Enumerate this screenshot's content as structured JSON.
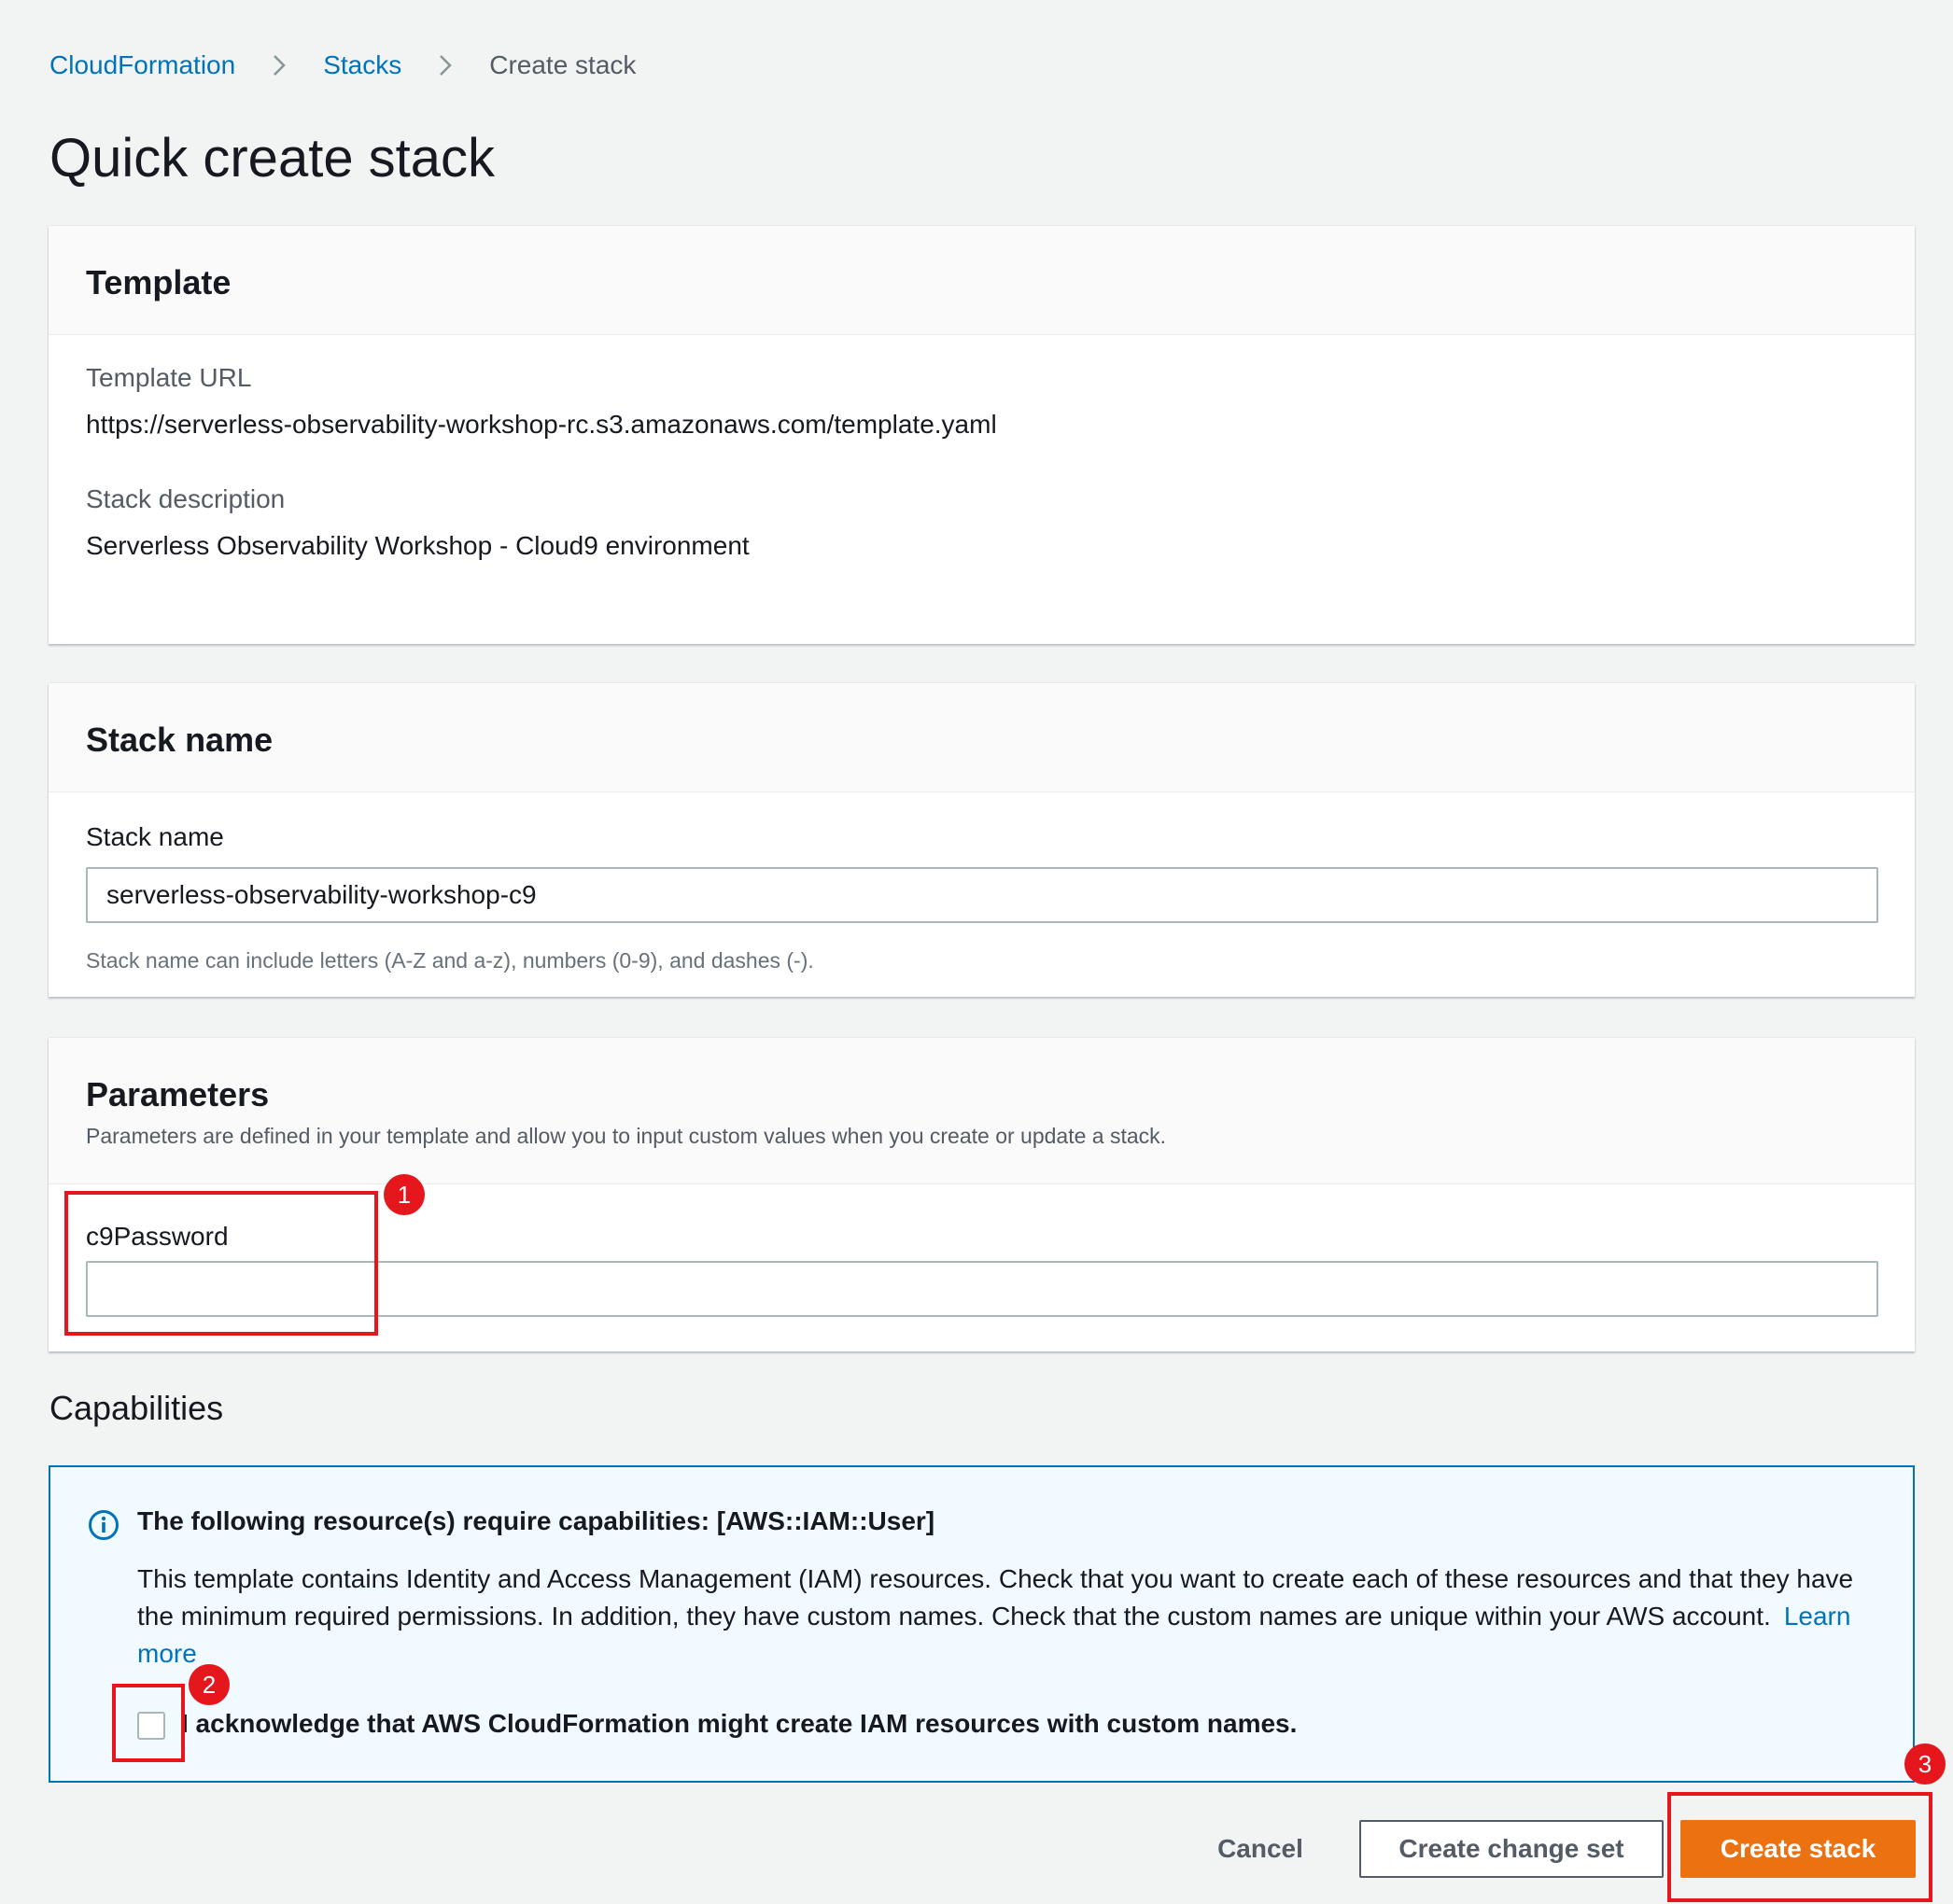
{
  "breadcrumb": {
    "items": [
      "CloudFormation",
      "Stacks"
    ],
    "current": "Create stack"
  },
  "page_title": "Quick create stack",
  "template_panel": {
    "title": "Template",
    "url_label": "Template URL",
    "url_value": "https://serverless-observability-workshop-rc.s3.amazonaws.com/template.yaml",
    "desc_label": "Stack description",
    "desc_value": "Serverless Observability Workshop - Cloud9 environment"
  },
  "stack_name_panel": {
    "title": "Stack name",
    "field_label": "Stack name",
    "field_value": "serverless-observability-workshop-c9",
    "hint": "Stack name can include letters (A-Z and a-z), numbers (0-9), and dashes (-)."
  },
  "parameters_panel": {
    "title": "Parameters",
    "description": "Parameters are defined in your template and allow you to input custom values when you create or update a stack.",
    "param_label": "c9Password",
    "param_value": ""
  },
  "capabilities": {
    "title": "Capabilities",
    "info_title": "The following resource(s) require capabilities: [AWS::IAM::User]",
    "info_text": "This template contains Identity and Access Management (IAM) resources. Check that you want to create each of these resources and that they have the minimum required permissions. In addition, they have custom names. Check that the custom names are unique within your AWS account.",
    "learn_more": "Learn more",
    "ack_label": "I acknowledge that AWS CloudFormation might create IAM resources with custom names.",
    "ack_checked": false
  },
  "actions": {
    "cancel": "Cancel",
    "create_change_set": "Create change set",
    "create_stack": "Create stack"
  },
  "annotations": {
    "badge_1": "1",
    "badge_2": "2",
    "badge_3": "3"
  },
  "colors": {
    "link": "#0073bb",
    "primary_button": "#ec7211",
    "annotation": "#e5161c",
    "info_border": "#0073bb",
    "info_background": "#f1faff"
  },
  "icons": [
    "chevron-right-icon",
    "info-icon"
  ]
}
